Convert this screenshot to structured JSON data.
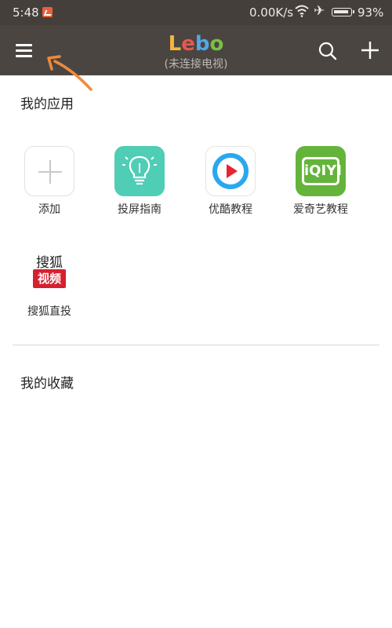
{
  "status_bar": {
    "time": "5:48",
    "network_speed": "0.00K/s",
    "battery_percent": "93%",
    "battery_level": 0.93,
    "icons": [
      "notification-icon",
      "wifi-icon",
      "airplane-icon",
      "battery-icon"
    ]
  },
  "app_bar": {
    "logo_letters": [
      "L",
      "e",
      "b",
      "o"
    ],
    "subtitle": "(未连接电视)",
    "icons": [
      "menu-icon",
      "search-icon",
      "add-icon"
    ],
    "colors": {
      "background": "#4a4541",
      "logo": [
        "#f4b63c",
        "#e7574d",
        "#55a6e8",
        "#7bc043"
      ]
    }
  },
  "my_apps": {
    "title": "我的应用",
    "items": [
      {
        "label": "添加",
        "icon": "add-icon"
      },
      {
        "label": "投屏指南",
        "icon": "lightbulb-icon"
      },
      {
        "label": "优酷教程",
        "icon": "youku-play-icon"
      },
      {
        "label": "爱奇艺教程",
        "icon": "iqiyi-logo-icon",
        "logo_text": "iQIYI"
      },
      {
        "label": "搜狐直投",
        "icon": "sohu-video-icon",
        "logo_top": "搜狐",
        "logo_bottom": "视频"
      }
    ]
  },
  "favorites": {
    "title": "我的收藏"
  }
}
